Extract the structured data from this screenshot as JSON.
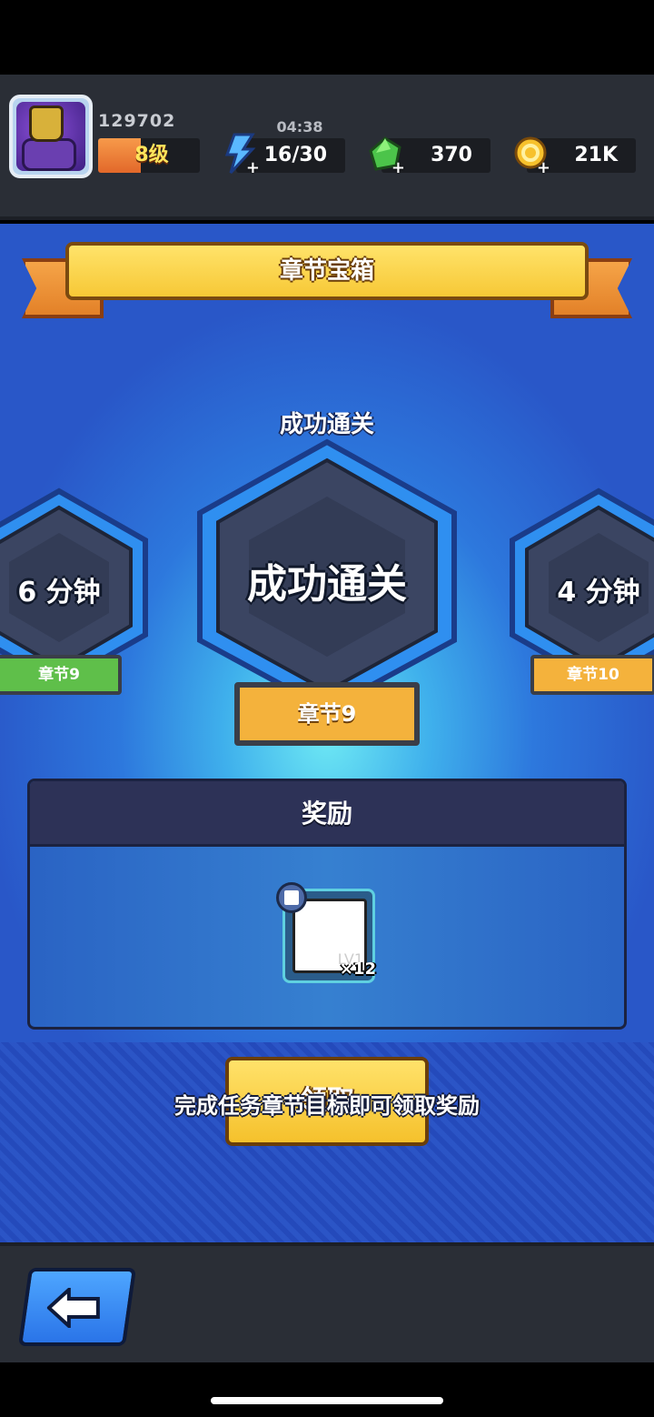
{
  "hud": {
    "player_id": "129702",
    "level_label": "8级",
    "level_progress": 0.42,
    "timer": "04:38",
    "energy": "16/30",
    "gems": "370",
    "coins": "21K"
  },
  "banner": {
    "title": "章节宝箱"
  },
  "chapters": {
    "heading": "成功通关",
    "left": {
      "time": "6 分钟",
      "tag": "章节9",
      "tag_color": "#5fbf4a"
    },
    "center": {
      "text": "成功通关",
      "tag": "章节9",
      "tag_color": "#f4b23c"
    },
    "right": {
      "time": "4 分钟",
      "tag": "章节10",
      "tag_color": "#f4b23c"
    }
  },
  "reward": {
    "header": "奖励",
    "item_level": "LV1",
    "item_qty": "×12"
  },
  "actions": {
    "claim_label": "领取",
    "hint": "完成任务章节目标即可领取奖励"
  },
  "colors": {
    "accent_yellow": "#f7c836",
    "hud_bg": "#2a2e36",
    "back_blue": "#2a74e8"
  }
}
